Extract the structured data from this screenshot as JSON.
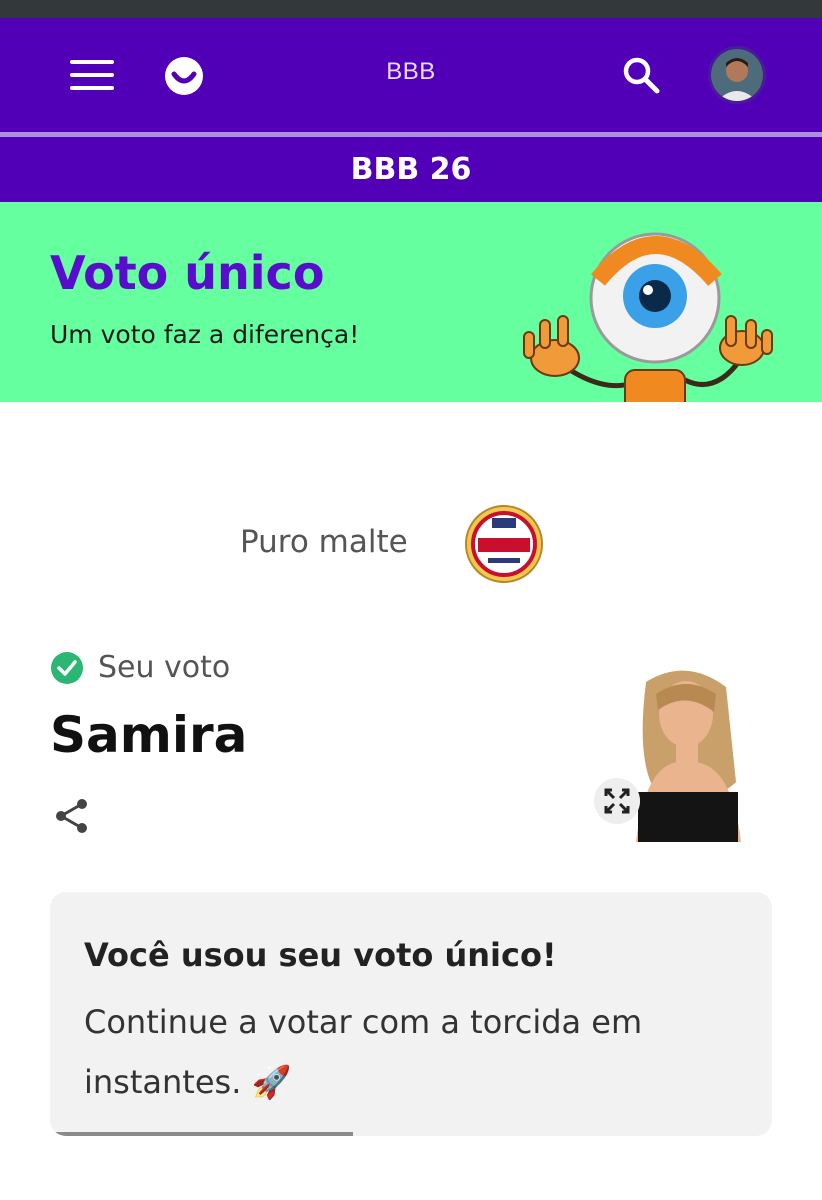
{
  "header": {
    "title": "BBB",
    "section_title": "BBB 26",
    "brand_color": "#5200b8"
  },
  "banner": {
    "title": "Voto único",
    "subtitle": "Um voto faz a diferença!",
    "background": "#66ff9f"
  },
  "sponsor": {
    "text": "Puro malte",
    "logo_name": "amstel-logo"
  },
  "vote": {
    "label": "Seu voto",
    "candidate": "Samira"
  },
  "info": {
    "title": "Você usou seu voto único!",
    "body": "Continue a votar com a torcida em instantes. 🚀",
    "progress": 0.42
  },
  "icons": [
    "menu-icon",
    "logo-icon",
    "search-icon",
    "avatar",
    "check-icon",
    "share-icon",
    "expand-icon"
  ]
}
